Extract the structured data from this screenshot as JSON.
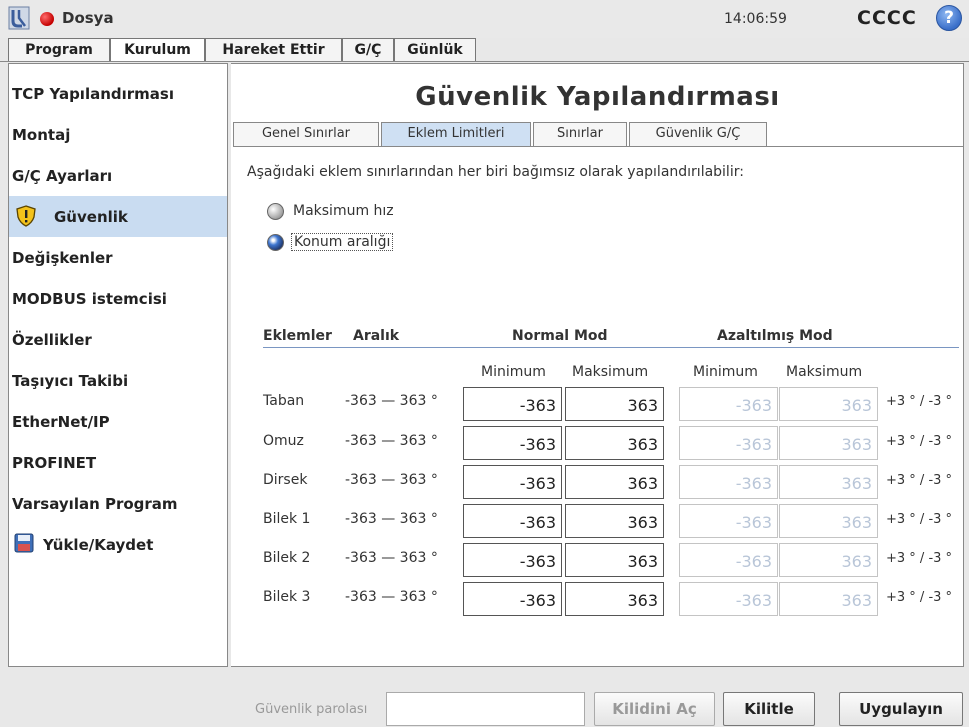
{
  "titlebar": {
    "file_label": "Dosya",
    "clock": "14:06:59",
    "robot_name": "CCCC",
    "help_glyph": "?"
  },
  "main_tabs": [
    {
      "label": "Program"
    },
    {
      "label": "Kurulum"
    },
    {
      "label": "Hareket Ettir"
    },
    {
      "label": "G/Ç"
    },
    {
      "label": "Günlük"
    }
  ],
  "sidebar": {
    "items": [
      {
        "label": "TCP Yapılandırması"
      },
      {
        "label": "Montaj"
      },
      {
        "label": "G/Ç Ayarları"
      },
      {
        "label": "Güvenlik"
      },
      {
        "label": "Değişkenler"
      },
      {
        "label": "MODBUS istemcisi"
      },
      {
        "label": "Özellikler"
      },
      {
        "label": "Taşıyıcı Takibi"
      },
      {
        "label": "EtherNet/IP"
      },
      {
        "label": "PROFINET"
      },
      {
        "label": "Varsayılan Program"
      },
      {
        "label": "Yükle/Kaydet"
      }
    ],
    "selected": "Güvenlik"
  },
  "content": {
    "title": "Güvenlik Yapılandırması",
    "subtabs": [
      {
        "label": "Genel Sınırlar"
      },
      {
        "label": "Eklem Limitleri"
      },
      {
        "label": "Sınırlar"
      },
      {
        "label": "Güvenlik G/Ç"
      }
    ],
    "description": "Aşağıdaki eklem sınırlarından her biri bağımsız olarak yapılandırılabilir:",
    "radio_max_speed": "Maksimum hız",
    "radio_position_range": "Konum aralığı",
    "table": {
      "headers": {
        "joints": "Eklemler",
        "range": "Aralık",
        "normal": "Normal Mod",
        "reduced": "Azaltılmış Mod"
      },
      "min_label": "Minimum",
      "max_label": "Maksimum",
      "rows": [
        {
          "joint": "Taban",
          "range": "-363 — 363 °",
          "normal_min": "-363",
          "normal_max": "363",
          "reduced_min": "-363",
          "reduced_max": "363",
          "tolerance": "+3 ° / -3 °"
        },
        {
          "joint": "Omuz",
          "range": "-363 — 363 °",
          "normal_min": "-363",
          "normal_max": "363",
          "reduced_min": "-363",
          "reduced_max": "363",
          "tolerance": "+3 ° / -3 °"
        },
        {
          "joint": "Dirsek",
          "range": "-363 — 363 °",
          "normal_min": "-363",
          "normal_max": "363",
          "reduced_min": "-363",
          "reduced_max": "363",
          "tolerance": "+3 ° / -3 °"
        },
        {
          "joint": "Bilek 1",
          "range": "-363 — 363 °",
          "normal_min": "-363",
          "normal_max": "363",
          "reduced_min": "-363",
          "reduced_max": "363",
          "tolerance": "+3 ° / -3 °"
        },
        {
          "joint": "Bilek 2",
          "range": "-363 — 363 °",
          "normal_min": "-363",
          "normal_max": "363",
          "reduced_min": "-363",
          "reduced_max": "363",
          "tolerance": "+3 ° / -3 °"
        },
        {
          "joint": "Bilek 3",
          "range": "-363 — 363 °",
          "normal_min": "-363",
          "normal_max": "363",
          "reduced_min": "-363",
          "reduced_max": "363",
          "tolerance": "+3 ° / -3 °"
        }
      ]
    }
  },
  "bottombar": {
    "password_label": "Güvenlik parolası",
    "password_value": "",
    "unlock_label": "Kilidini Aç",
    "lock_label": "Kilitle",
    "apply_label": "Uygulayın"
  },
  "colors": {
    "selected_sidebar": "#c9dcf1",
    "selected_subtab": "#cfe0f3",
    "header_rule": "#7a96c2",
    "disabled_value": "#b9c6d8"
  },
  "icons": [
    "ur-logo-icon",
    "record-status-icon",
    "help-icon",
    "warning-shield-icon",
    "save-disk-icon",
    "radio-off-icon",
    "radio-on-icon"
  ]
}
